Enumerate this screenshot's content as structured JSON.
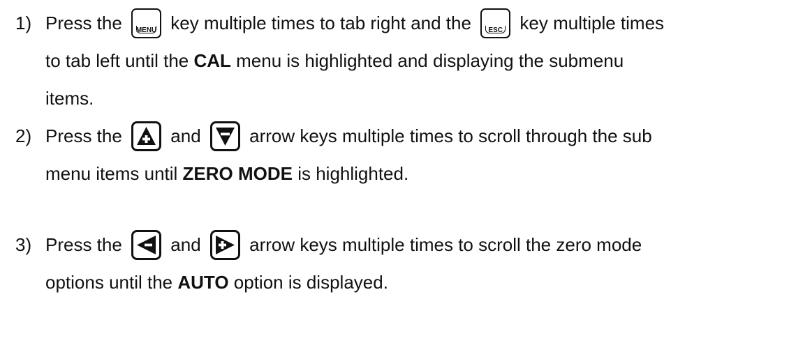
{
  "steps": [
    {
      "number": "1)",
      "lines": [
        [
          "Press the",
          "menu-key",
          "key multiple times to tab right and the",
          "esc-key",
          "key multiple times"
        ],
        [
          "to tab left until the",
          {
            "bold": "CAL"
          },
          "menu is highlighted and displaying the submenu"
        ],
        [
          "items."
        ]
      ]
    },
    {
      "number": "2)",
      "lines": [
        [
          "Press the",
          "up-arrow-key",
          "and",
          "down-arrow-key",
          "arrow keys multiple times to scroll through the sub"
        ],
        [
          "menu items until",
          {
            "bold": "ZERO MODE"
          },
          "is highlighted."
        ]
      ]
    },
    {
      "number": "3)",
      "lines": [
        [
          "Press the",
          "left-arrow-key",
          "and",
          "right-arrow-key",
          "arrow keys multiple times to scroll the zero mode"
        ],
        [
          "options until the",
          {
            "bold": "AUTO"
          },
          "option is displayed."
        ]
      ]
    }
  ],
  "keys": {
    "menu_label": "MENU",
    "esc_label": "ESC"
  },
  "text": {
    "s1_l1_a": "Press the ",
    "s1_l1_b": " key multiple times to tab right and the ",
    "s1_l1_c": " key multiple times",
    "s1_l2_a": "to tab left until the ",
    "s1_l2_b": "CAL",
    "s1_l2_c": " menu is highlighted and displaying the submenu",
    "s1_l3": "items.",
    "s2_l1_a": "Press the ",
    "s2_l1_b": " and ",
    "s2_l1_c": " arrow keys multiple times to scroll through the sub",
    "s2_l2_a": "menu items until ",
    "s2_l2_b": "ZERO MODE",
    "s2_l2_c": " is highlighted.",
    "s3_l1_a": "Press the ",
    "s3_l1_b": " and ",
    "s3_l1_c": " arrow keys multiple times to scroll the zero mode",
    "s3_l2_a": "options until the ",
    "s3_l2_b": "AUTO",
    "s3_l2_c": " option is displayed.",
    "n1": "1)",
    "n2": "2)",
    "n3": "3)"
  }
}
